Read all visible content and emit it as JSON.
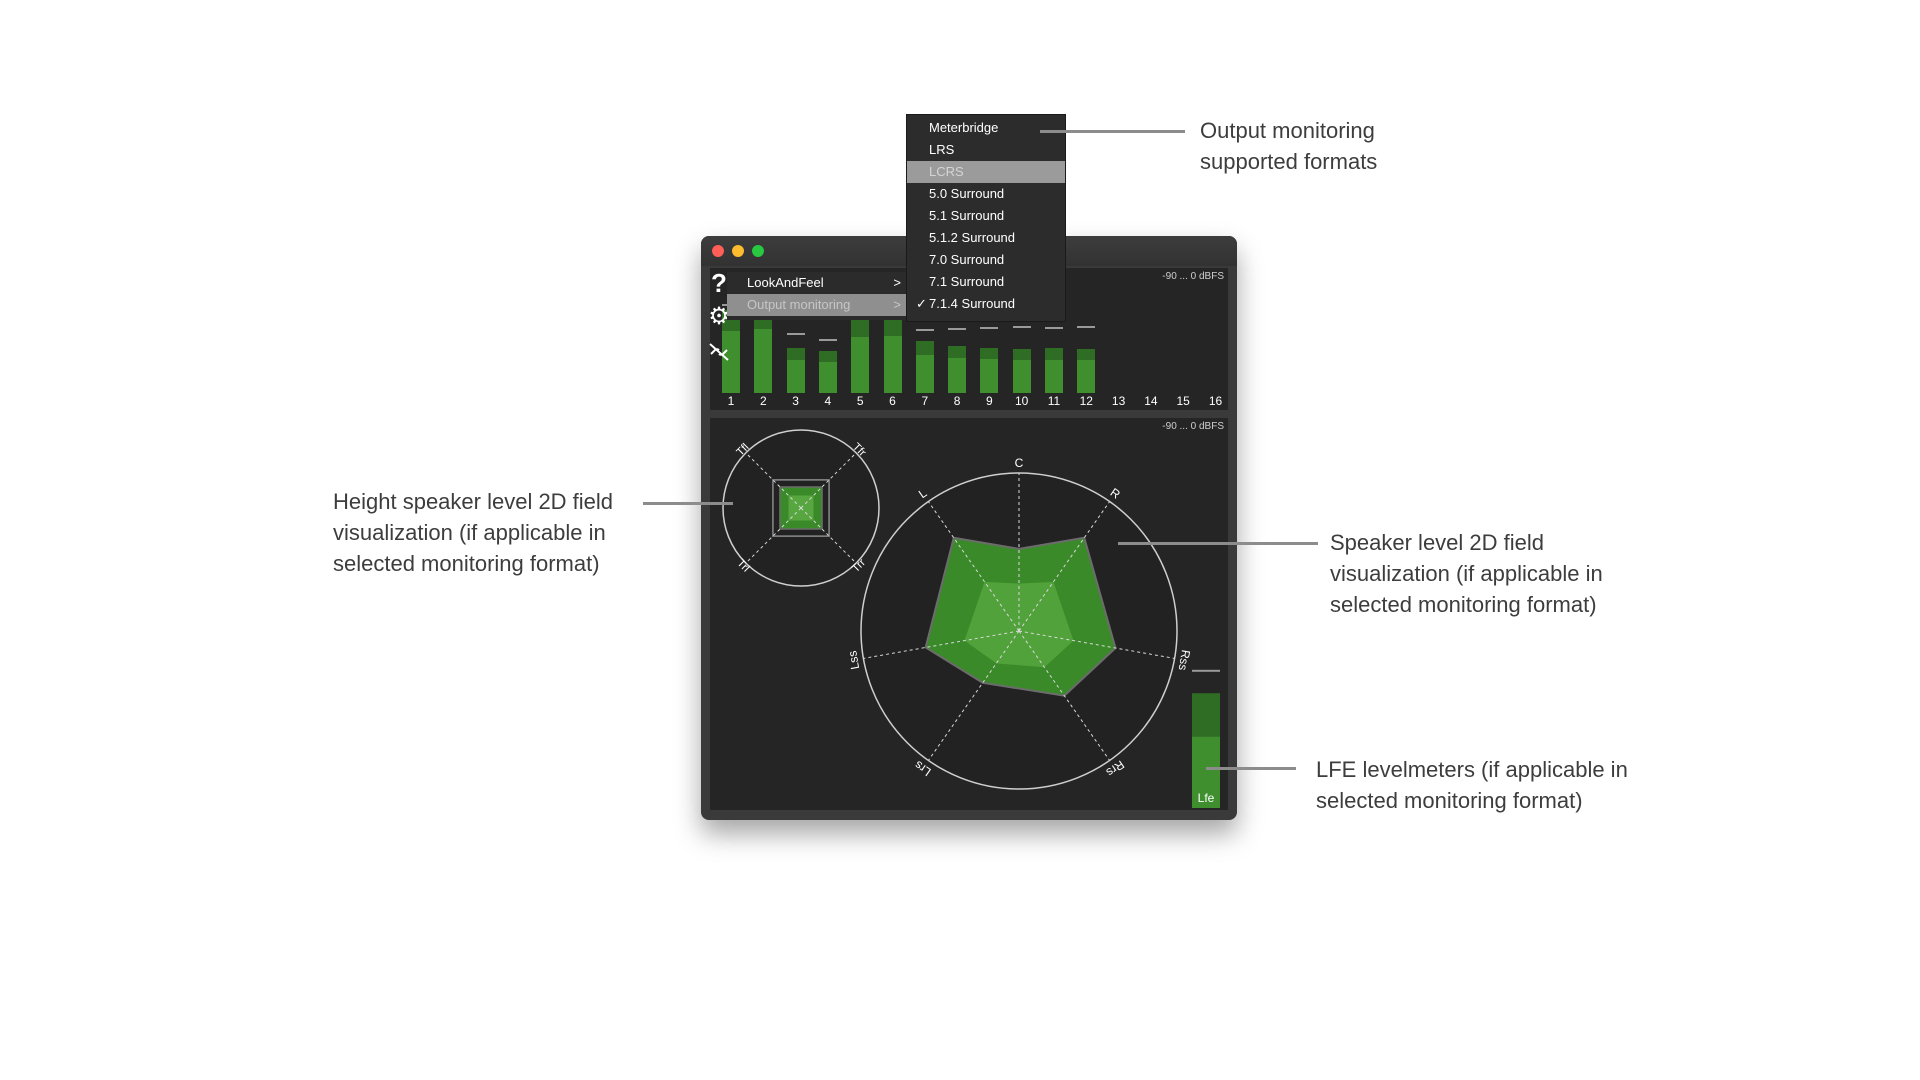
{
  "window": {
    "traffic_lights": {
      "close": "#ff5f57",
      "minimize": "#febc2e",
      "zoom": "#28c840"
    },
    "meter_range_label": "-90 ... 0 dBFS",
    "field_range_label": "-90 ... 0 dBFS",
    "side_icons": [
      "help-icon",
      "gear-icon",
      "unlink-icon"
    ],
    "help_glyph": "?",
    "gear_glyph": "⚙"
  },
  "context_menu": {
    "items": [
      {
        "label": "LookAndFeel",
        "arrow": ">"
      },
      {
        "label": "Output monitoring",
        "arrow": ">"
      }
    ]
  },
  "output_formats": {
    "items": [
      "Meterbridge",
      "LRS",
      "LCRS",
      "5.0 Surround",
      "5.1 Surround",
      "5.1.2 Surround",
      "7.0 Surround",
      "7.1 Surround",
      "7.1.4 Surround"
    ],
    "highlighted": "LCRS",
    "selected": "7.1.4 Surround",
    "check_glyph": "✓"
  },
  "meterbridge": {
    "channels": [
      {
        "label": "1",
        "level": 0.83,
        "rms": 0.62,
        "peak": 0.85
      },
      {
        "label": "2",
        "level": 0.85,
        "rms": 0.64,
        "peak": 0.87
      },
      {
        "label": "3",
        "level": 0.45,
        "rms": 0.33,
        "peak": 0.56
      },
      {
        "label": "4",
        "level": 0.42,
        "rms": 0.31,
        "peak": 0.5
      },
      {
        "label": "5",
        "level": 0.8,
        "rms": 0.56,
        "peak": 0.82
      },
      {
        "label": "6",
        "level": 0.81,
        "rms": 0.57,
        "peak": 0.83
      },
      {
        "label": "7",
        "level": 0.52,
        "rms": 0.38,
        "peak": 0.6
      },
      {
        "label": "8",
        "level": 0.47,
        "rms": 0.35,
        "peak": 0.61
      },
      {
        "label": "9",
        "level": 0.45,
        "rms": 0.34,
        "peak": 0.62
      },
      {
        "label": "10",
        "level": 0.44,
        "rms": 0.33,
        "peak": 0.63
      },
      {
        "label": "11",
        "level": 0.45,
        "rms": 0.33,
        "peak": 0.62
      },
      {
        "label": "12",
        "level": 0.44,
        "rms": 0.33,
        "peak": 0.63
      },
      {
        "label": "13",
        "level": 0,
        "rms": 0,
        "peak": 0
      },
      {
        "label": "14",
        "level": 0,
        "rms": 0,
        "peak": 0
      },
      {
        "label": "15",
        "level": 0,
        "rms": 0,
        "peak": 0
      },
      {
        "label": "16",
        "level": 0,
        "rms": 0,
        "peak": 0
      }
    ],
    "colors": {
      "level": "#3f8f2e",
      "rms": "#2f6c24",
      "peak": "#9a9a9a"
    }
  },
  "height_field": {
    "speakers": [
      "Tfl",
      "Tfr",
      "Trr",
      "Trl"
    ],
    "peak_level": 0.27,
    "rms_level": 0.16
  },
  "speaker_field": {
    "speakers": [
      {
        "label": "C",
        "peak": 0.52,
        "rms": 0.3
      },
      {
        "label": "R",
        "peak": 0.72,
        "rms": 0.38
      },
      {
        "label": "Rss",
        "peak": 0.62,
        "rms": 0.35
      },
      {
        "label": "Rrs",
        "peak": 0.5,
        "rms": 0.28
      },
      {
        "label": "Lrs",
        "peak": 0.4,
        "rms": 0.25
      },
      {
        "label": "Lss",
        "peak": 0.6,
        "rms": 0.35
      },
      {
        "label": "L",
        "peak": 0.72,
        "rms": 0.38
      }
    ],
    "colors": {
      "peak": "#3a8a2a",
      "rms": "#57a63f",
      "outline": "#6c6c6c"
    }
  },
  "lfe": {
    "label": "Lfe",
    "level": 0.82,
    "rms": 0.51,
    "peak": 0.93
  },
  "annotations": {
    "output_formats": [
      "Output monitoring",
      "supported formats"
    ],
    "height_field": [
      "Height speaker level 2D field",
      "visualization (if applicable in",
      "selected monitoring format)"
    ],
    "speaker_field": [
      "Speaker level 2D field",
      "visualization (if applicable in",
      "selected monitoring format)"
    ],
    "lfe": [
      "LFE levelmeters (if applicable in",
      "selected monitoring format)"
    ]
  }
}
